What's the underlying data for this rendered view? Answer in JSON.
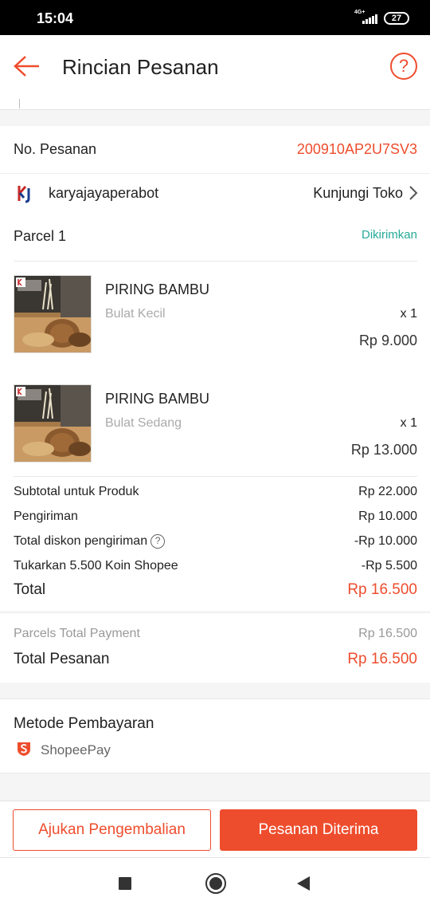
{
  "status_bar": {
    "time": "15:04",
    "network": "4G+",
    "battery": "27"
  },
  "header": {
    "title": "Rincian Pesanan",
    "help": "?"
  },
  "order": {
    "label": "No. Pesanan",
    "number": "200910AP2U7SV3"
  },
  "shop": {
    "name": "karyajayaperabot",
    "visit_label": "Kunjungi Toko"
  },
  "parcel": {
    "label": "Parcel 1",
    "status": "Dikirimkan",
    "items": [
      {
        "name": "PIRING BAMBU",
        "variant": "Bulat Kecil",
        "qty": "x 1",
        "price": "Rp 9.000"
      },
      {
        "name": "PIRING BAMBU",
        "variant": "Bulat Sedang",
        "qty": "x 1",
        "price": "Rp 13.000"
      }
    ],
    "summary": {
      "subtotal_label": "Subtotal untuk Produk",
      "subtotal": "Rp 22.000",
      "shipping_label": "Pengiriman",
      "shipping": "Rp 10.000",
      "shipping_discount_label": "Total diskon pengiriman",
      "shipping_discount": "-Rp 10.000",
      "coins_label": "Tukarkan 5.500 Koin Shopee",
      "coins": "-Rp 5.500",
      "total_label": "Total",
      "total": "Rp 16.500"
    }
  },
  "payment_summary": {
    "parcels_label": "Parcels Total Payment",
    "parcels_value": "Rp 16.500",
    "order_total_label": "Total Pesanan",
    "order_total": "Rp 16.500"
  },
  "payment_method": {
    "label": "Metode Pembayaran",
    "value": "ShopeePay"
  },
  "actions": {
    "return_label": "Ajukan Pengembalian",
    "received_label": "Pesanan Diterima"
  },
  "colors": {
    "accent": "#ee4d2d",
    "status_green": "#26aa99"
  }
}
